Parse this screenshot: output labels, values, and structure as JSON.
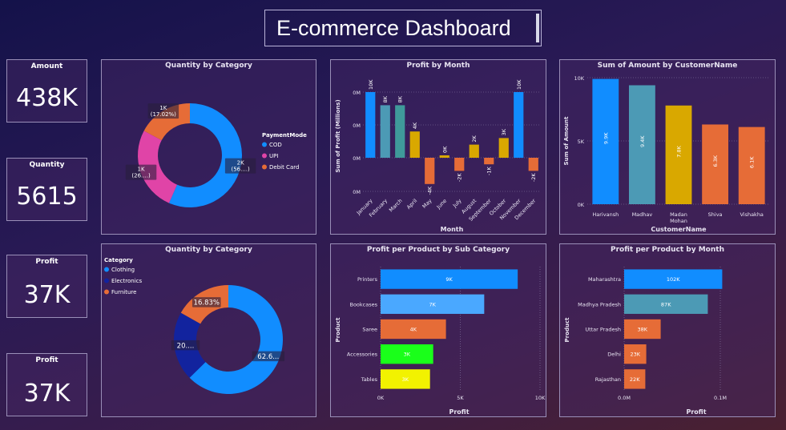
{
  "title": "E-commerce Dashboard",
  "kpis": [
    {
      "label": "Amount",
      "value": "438K"
    },
    {
      "label": "Quantity",
      "value": "5615"
    },
    {
      "label": "Profit",
      "value": "37K"
    },
    {
      "label": "Profit",
      "value": "37K"
    }
  ],
  "colors": {
    "blue": "#118dff",
    "pink": "#e044a7",
    "orange": "#e66c37",
    "navy": "#12239e",
    "teal": "#4c9ab5",
    "tealdark": "#3f9a9a",
    "gold": "#d9a800",
    "green": "#1aff1a",
    "yellow": "#f2f200",
    "lightblue": "#4aa8ff"
  },
  "donut1": {
    "title": "Quantity by Category",
    "legend_title": "PaymentMode",
    "legend": [
      "COD",
      "UPI",
      "Debit Card"
    ],
    "slices": [
      {
        "name": "COD",
        "value": 56,
        "label": "2K\n(56....)",
        "color": "#118dff"
      },
      {
        "name": "UPI",
        "value": 26,
        "label": "1K\n(26....)",
        "color": "#e044a7"
      },
      {
        "name": "Debit Card",
        "value": 17.02,
        "label": "1K\n(17.02%)",
        "color": "#e66c37"
      }
    ]
  },
  "donut2": {
    "title": "Quantity by Category",
    "legend_title": "Category",
    "legend": [
      "Clothing",
      "Electronics",
      "Furniture"
    ],
    "slices": [
      {
        "name": "Clothing",
        "value": 62.6,
        "label": "62.6...",
        "color": "#118dff"
      },
      {
        "name": "Electronics",
        "value": 20.57,
        "label": "20....",
        "color": "#12239e"
      },
      {
        "name": "Furniture",
        "value": 16.83,
        "label": "16.83%",
        "color": "#e66c37"
      }
    ]
  },
  "chart_data": [
    {
      "type": "bar",
      "title": "Profit by Month",
      "xlabel": "Month",
      "ylabel": "Sum of Profit (Millions)",
      "ytick_labels": [
        "0M",
        "0M",
        "0M",
        "0M"
      ],
      "categories": [
        "January",
        "February",
        "March",
        "April",
        "May",
        "June",
        "July",
        "August",
        "September",
        "October",
        "November",
        "December"
      ],
      "values": [
        10,
        8,
        8,
        4,
        -4,
        0,
        -2,
        2,
        -1,
        3,
        10,
        -2
      ],
      "value_labels": [
        "10K",
        "8K",
        "8K",
        "4K",
        "-4K",
        "0K",
        "-2K",
        "2K",
        "-1K",
        "3K",
        "10K",
        "-2K"
      ],
      "colors": [
        "#118dff",
        "#4c9ab5",
        "#3f9a9a",
        "#d9a800",
        "#e66c37",
        "#d9a800",
        "#e66c37",
        "#d9a800",
        "#e66c37",
        "#d9a800",
        "#118dff",
        "#e66c37"
      ]
    },
    {
      "type": "bar",
      "title": "Sum of Amount by CustomerName",
      "xlabel": "CustomerName",
      "ylabel": "Sum of Amount",
      "ytick_labels": [
        "10K",
        "5K",
        "0K"
      ],
      "ylim": [
        0,
        10
      ],
      "categories": [
        "Harivansh",
        "Madhav",
        "Madan Mohan",
        "Shiva",
        "Vishakha"
      ],
      "values": [
        9.9,
        9.4,
        7.8,
        6.3,
        6.1
      ],
      "value_labels": [
        "9.9K",
        "9.4K",
        "7.8K",
        "6.3K",
        "6.1K"
      ],
      "colors": [
        "#118dff",
        "#4c9ab5",
        "#d9a800",
        "#e66c37",
        "#e66c37"
      ]
    },
    {
      "type": "bar",
      "orientation": "horizontal",
      "title": "Profit per Product by Sub Category",
      "xlabel": "Profit",
      "ylabel": "Product",
      "xtick_labels": [
        "0K",
        "5K",
        "10K"
      ],
      "xlim": [
        0,
        10
      ],
      "categories": [
        "Printers",
        "Bookcases",
        "Saree",
        "Accessories",
        "Tables"
      ],
      "values": [
        8.6,
        6.5,
        4.1,
        3.3,
        3.1
      ],
      "value_labels": [
        "9K",
        "7K",
        "4K",
        "3K",
        "3K"
      ],
      "colors": [
        "#118dff",
        "#4aa8ff",
        "#e66c37",
        "#1aff1a",
        "#f2f200"
      ]
    },
    {
      "type": "bar",
      "orientation": "horizontal",
      "title": "Profit per Product by Month",
      "xlabel": "Profit",
      "ylabel": "Product",
      "xtick_labels": [
        "0.0M",
        "0.1M"
      ],
      "xlim": [
        0,
        0.1
      ],
      "categories": [
        "Maharashtra",
        "Madhya Pradesh",
        "Uttar Pradesh",
        "Delhi",
        "Rajasthan"
      ],
      "values": [
        0.102,
        0.087,
        0.038,
        0.023,
        0.022
      ],
      "value_labels": [
        "102K",
        "87K",
        "38K",
        "23K",
        "22K"
      ],
      "colors": [
        "#118dff",
        "#4c9ab5",
        "#e66c37",
        "#e66c37",
        "#e66c37"
      ]
    }
  ]
}
